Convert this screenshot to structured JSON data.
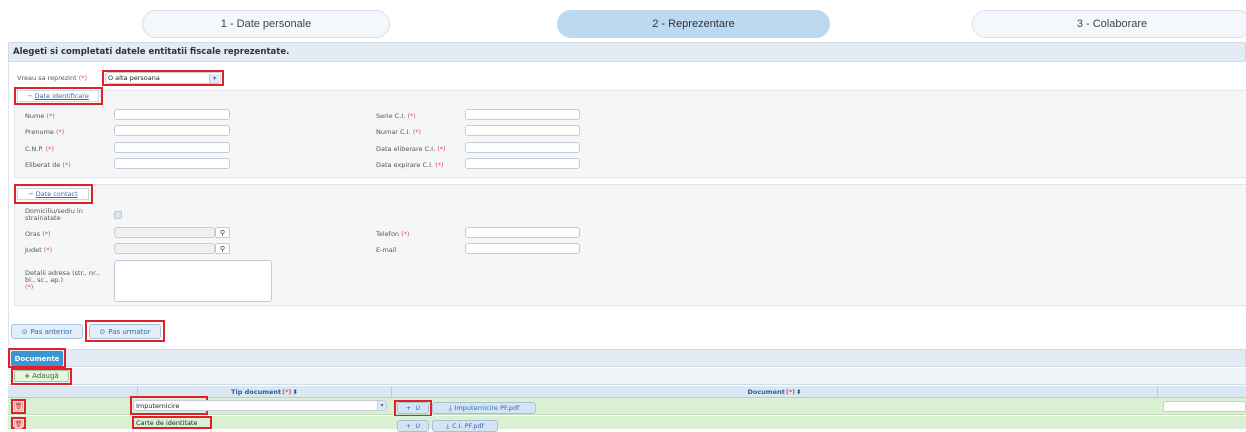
{
  "steps": [
    "1 - Date personale",
    "2 - Reprezentare",
    "3 - Colaborare"
  ],
  "panel_title": "Alegeti si completati datele entitatii fiscale reprezentate.",
  "reprezint": {
    "label": "Vreau sa reprezint",
    "req": "(*)",
    "value": "O alta persoana"
  },
  "date_identificare": {
    "title": "Date identificare",
    "toggle": "−",
    "fields_left": [
      {
        "label": "Nume",
        "req": "(*)"
      },
      {
        "label": "Prenume",
        "req": "(*)"
      },
      {
        "label": "C.N.P.",
        "req": "(*)"
      },
      {
        "label": "Eliberat de",
        "req": "(*)"
      }
    ],
    "fields_right": [
      {
        "label": "Serie C.I.",
        "req": "(*)"
      },
      {
        "label": "Numar C.I.",
        "req": "(*)"
      },
      {
        "label": "Data eliberare C.I.",
        "req": "(*)"
      },
      {
        "label": "Data expirare C.I.",
        "req": "(*)"
      }
    ]
  },
  "date_contact": {
    "title": "Date contact",
    "toggle": "−",
    "domiciliu_label_1": "Domiciliu/sediu in",
    "domiciliu_label_2": "strainatate",
    "oras": {
      "label": "Oras",
      "req": "(*)"
    },
    "judet": {
      "label": "Judet",
      "req": "(*)"
    },
    "telefon": {
      "label": "Telefon",
      "req": "(*)"
    },
    "email": {
      "label": "E-mail"
    },
    "adresa_label_1": "Detalii adresa (str., nr.,",
    "adresa_label_2": "bl., sc., ap.)",
    "adresa_req": "(*)"
  },
  "nav": {
    "prev": "Pas anterior",
    "next": "Pas urmator"
  },
  "documente": {
    "tab": "Documente",
    "add": "Adaugă",
    "col_tip": "Tip document",
    "col_doc": "Document",
    "req": "(*)",
    "sort": "⬍",
    "rows": [
      {
        "tip": "Imputernicire",
        "upload": "U",
        "file": "Imputernicire PF.pdf"
      },
      {
        "tip": "Carte de identitate",
        "upload": "U",
        "file": "C.I. PF.pdf"
      }
    ]
  },
  "colors": {
    "accent": "#3a95d3",
    "row_green": "#d9f0d3",
    "red": "#e0202a"
  }
}
